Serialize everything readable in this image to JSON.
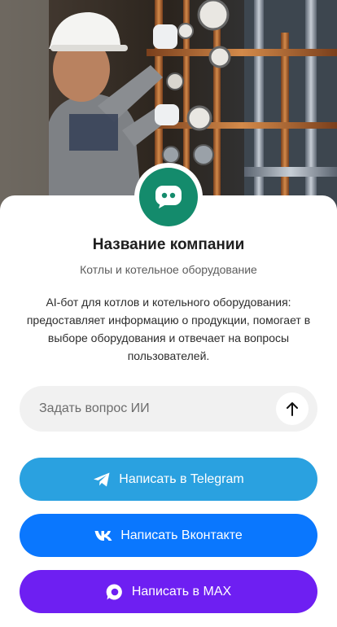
{
  "company": {
    "name": "Название компании",
    "category": "Котлы и котельное оборудование",
    "description": "AI-бот для котлов и котельного оборудования: предоставляет информацию о продукции, помогает в выборе оборудования и отвечает на вопросы пользователей."
  },
  "hero": {
    "image": "boiler-room-technician-photo"
  },
  "avatar": {
    "icon": "chat-bot-icon",
    "color": "#148b6c"
  },
  "ask": {
    "placeholder": "Задать вопрос ИИ",
    "send_icon": "arrow-up-icon"
  },
  "buttons": [
    {
      "label": "Написать в Telegram",
      "icon": "telegram-icon",
      "color": "#2aa1e0"
    },
    {
      "label": "Написать Вконтакте",
      "icon": "vk-icon",
      "color": "#0a77fe"
    },
    {
      "label": "Написать в MAX",
      "icon": "max-icon",
      "color": "#6e1ff2"
    }
  ]
}
